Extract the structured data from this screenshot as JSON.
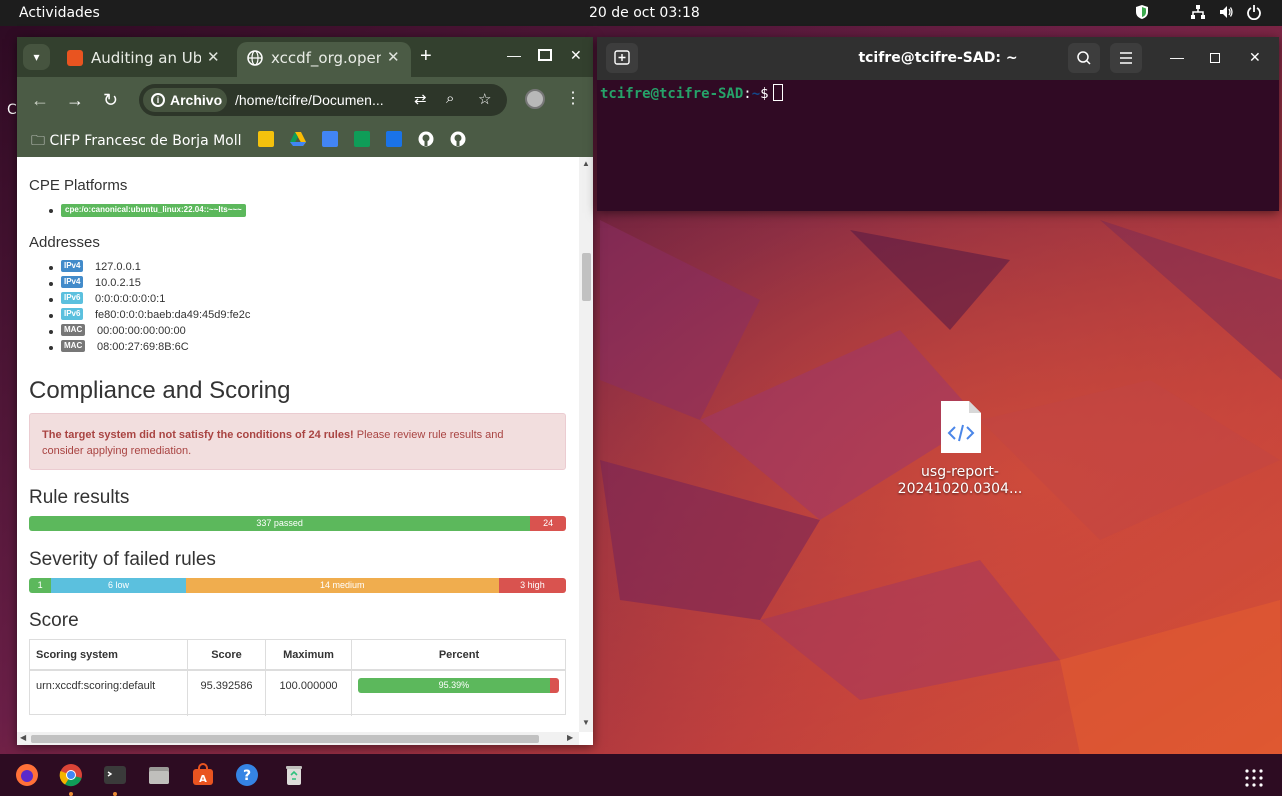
{
  "topbar": {
    "activities": "Actividades",
    "clock": "20 de oct  03:18"
  },
  "desktop": {
    "partial_label": "C",
    "file": {
      "name_line1": "usg-report-",
      "name_line2": "20241020.0304..."
    }
  },
  "browser": {
    "tabs": [
      {
        "title": "Auditing an Ubu",
        "favicon": "ubuntu-icon",
        "active": false
      },
      {
        "title": "xccdf_org.open",
        "favicon": "globe-icon",
        "active": true
      }
    ],
    "omnibox": {
      "badge": "Archivo",
      "url": "/home/tcifre/Documen..."
    },
    "bookmarks": {
      "folder": "CIFP Francesc de Borja Moll"
    }
  },
  "report": {
    "cpe_heading": "CPE Platforms",
    "cpe": "cpe:/o:canonical:ubuntu_linux:22.04::~~lts~~~",
    "addresses_heading": "Addresses",
    "addresses": [
      {
        "type": "IPv4",
        "value": "127.0.0.1"
      },
      {
        "type": "IPv4",
        "value": "10.0.2.15"
      },
      {
        "type": "IPv6",
        "value": "0:0:0:0:0:0:0:1"
      },
      {
        "type": "IPv6",
        "value": "fe80:0:0:0:baeb:da49:45d9:fe2c"
      },
      {
        "type": "MAC",
        "value": "00:00:00:00:00:00"
      },
      {
        "type": "MAC",
        "value": "08:00:27:69:8B:6C"
      }
    ],
    "compliance_heading": "Compliance and Scoring",
    "alert_strong": "The target system did not satisfy the conditions of 24 rules!",
    "alert_line1_rest": " Please review rule results and",
    "alert_line2": "consider applying remediation.",
    "rule_results_heading": "Rule results",
    "rule_results": {
      "passed": 337,
      "passed_label": "337 passed",
      "failed": 24,
      "failed_label": "24"
    },
    "severity_heading": "Severity of failed rules",
    "severity": [
      {
        "label": "1",
        "count": 1,
        "color": "#5cb85c"
      },
      {
        "label": "6 low",
        "count": 6,
        "color": "#5bc0de"
      },
      {
        "label": "14 medium",
        "count": 14,
        "color": "#f0ad4e"
      },
      {
        "label": "3 high",
        "count": 3,
        "color": "#d9534f"
      }
    ],
    "score_heading": "Score",
    "score_table": {
      "headers": [
        "Scoring system",
        "Score",
        "Maximum",
        "Percent"
      ],
      "row": {
        "system": "urn:xccdf:scoring:default",
        "score": "95.392586",
        "maximum": "100.000000",
        "percent_label": "95.39%",
        "percent": 95.39
      }
    }
  },
  "terminal": {
    "title": "tcifre@tcifre-SAD: ~",
    "prompt_user": "tcifre@tcifre-SAD",
    "prompt_sep": ":",
    "prompt_path": "~",
    "prompt_symbol": "$"
  },
  "colors": {
    "passed": "#5cb85c",
    "failed": "#d9534f",
    "ipv4": "#428bca",
    "ipv6": "#5bc0de",
    "mac": "#777777",
    "browser_frame": "#4b5b45"
  }
}
